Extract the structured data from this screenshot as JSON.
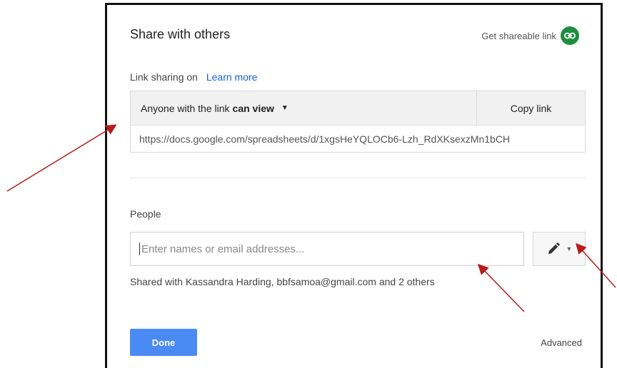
{
  "dialog": {
    "title": "Share with others",
    "shareable_link_label": "Get shareable link",
    "link_sharing": {
      "status_text": "Link sharing on",
      "learn_more": "Learn more",
      "access_prefix": "Anyone with the link",
      "access_level": "can view",
      "copy_link": "Copy link",
      "url": "https://docs.google.com/spreadsheets/d/1xgsHeYQLOCb6-Lzh_RdXKsexzMn1bCH"
    },
    "people": {
      "label": "People",
      "placeholder": "Enter names or email addresses...",
      "shared_with": "Shared with Kassandra Harding, bbfsamoa@gmail.com and 2 others"
    },
    "done_button": "Done",
    "advanced_link": "Advanced"
  },
  "colors": {
    "link_icon_bg": "#1e8e3e",
    "done_bg": "#4a8af4",
    "learn_more": "#1a5fd1",
    "annotation_arrow": "#b71c1c"
  },
  "icons": [
    "link-icon",
    "dropdown-caret-icon",
    "pencil-icon",
    "chevron-down-icon"
  ]
}
